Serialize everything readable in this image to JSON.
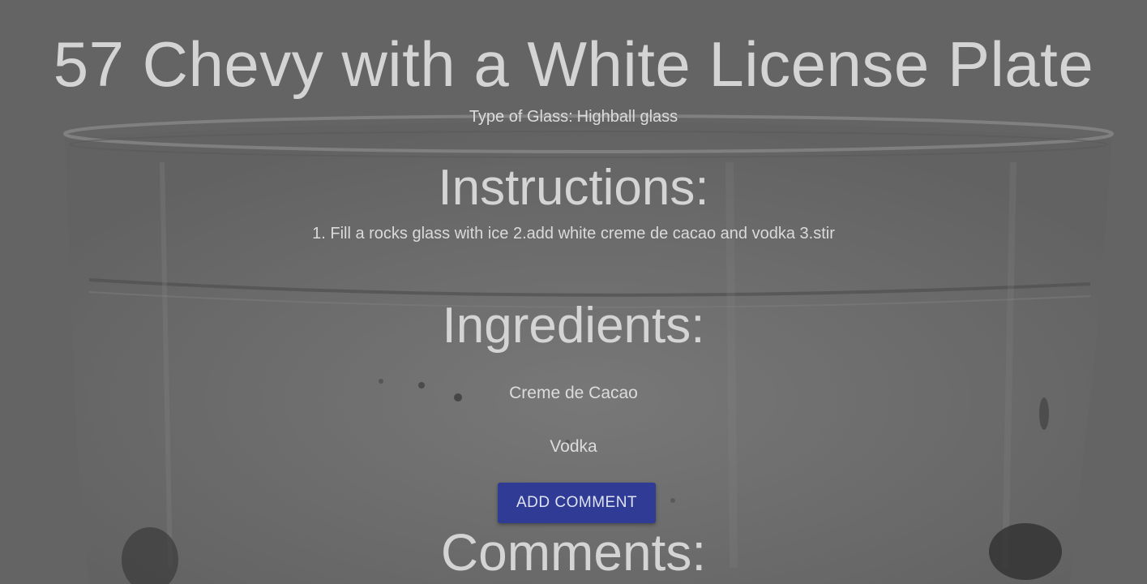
{
  "drink": {
    "title": "57 Chevy with a White License Plate",
    "glass_label": "Type of Glass:",
    "glass_value": "Highball glass"
  },
  "instructions": {
    "heading": "Instructions:",
    "text": "1. Fill a rocks glass with ice 2.add white creme de cacao and vodka 3.stir"
  },
  "ingredients": {
    "heading": "Ingredients:",
    "items": [
      "Creme de Cacao",
      "Vodka"
    ]
  },
  "actions": {
    "add_comment_label": "ADD COMMENT"
  },
  "comments": {
    "heading": "Comments:"
  },
  "colors": {
    "overlay": "#646464",
    "button": "#2f3b94",
    "text": "#d2d2d2"
  }
}
